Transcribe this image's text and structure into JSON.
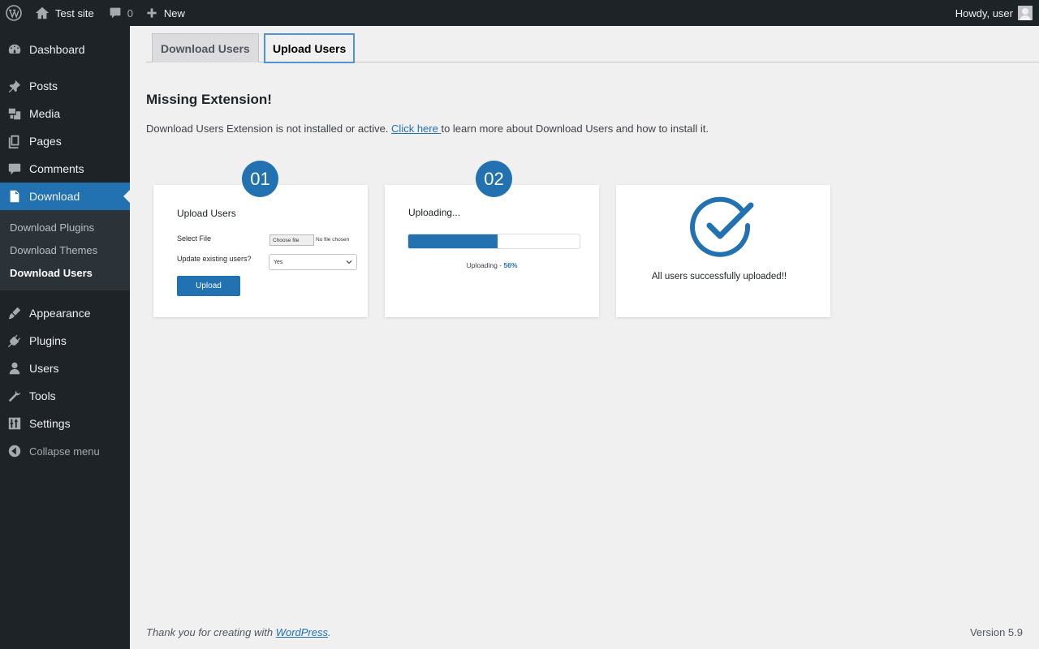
{
  "admin_bar": {
    "site_name": "Test site",
    "comments_count": "0",
    "new_label": "New",
    "howdy": "Howdy, user"
  },
  "sidebar": {
    "items_top": [
      {
        "label": "Dashboard",
        "icon": "dashboard-icon"
      },
      {
        "label": "Posts",
        "icon": "pin-icon"
      },
      {
        "label": "Media",
        "icon": "media-icon"
      },
      {
        "label": "Pages",
        "icon": "pages-icon"
      },
      {
        "label": "Comments",
        "icon": "comment-icon"
      }
    ],
    "current": {
      "label": "Download",
      "icon": "download-icon"
    },
    "submenu": [
      "Download Plugins",
      "Download Themes",
      "Download Users"
    ],
    "items_bottom": [
      {
        "label": "Appearance",
        "icon": "brush-icon"
      },
      {
        "label": "Plugins",
        "icon": "plug-icon"
      },
      {
        "label": "Users",
        "icon": "user-icon"
      },
      {
        "label": "Tools",
        "icon": "wrench-icon"
      },
      {
        "label": "Settings",
        "icon": "settings-icon"
      }
    ],
    "collapse": "Collapse menu"
  },
  "tabs": [
    "Download Users",
    "Upload Users"
  ],
  "heading": "Missing Extension!",
  "notice": {
    "before": "Download Users Extension is not installed or active. ",
    "link": "Click here ",
    "after": "to learn more about Download Users and how to install it."
  },
  "steps": {
    "badge1": "01",
    "badge2": "02",
    "card1": {
      "title": "Upload Users",
      "select_file": "Select File",
      "choose_file": "Choose file",
      "no_file": "No file chosen",
      "update_existing": "Update existing users?",
      "select_value": "Yes",
      "button": "Upload"
    },
    "card2": {
      "title": "Uploading...",
      "progress_label": "Uploading - ",
      "progress_value": "56%",
      "progress": 0.52
    },
    "card3": {
      "message": "All users successfully uploaded!!"
    }
  },
  "footer": {
    "thanks": "Thank you for creating with ",
    "link": "WordPress",
    "period": ".",
    "version": "Version 5.9"
  },
  "colors": {
    "accent": "#2271b1",
    "sidebar": "#1d2327"
  }
}
